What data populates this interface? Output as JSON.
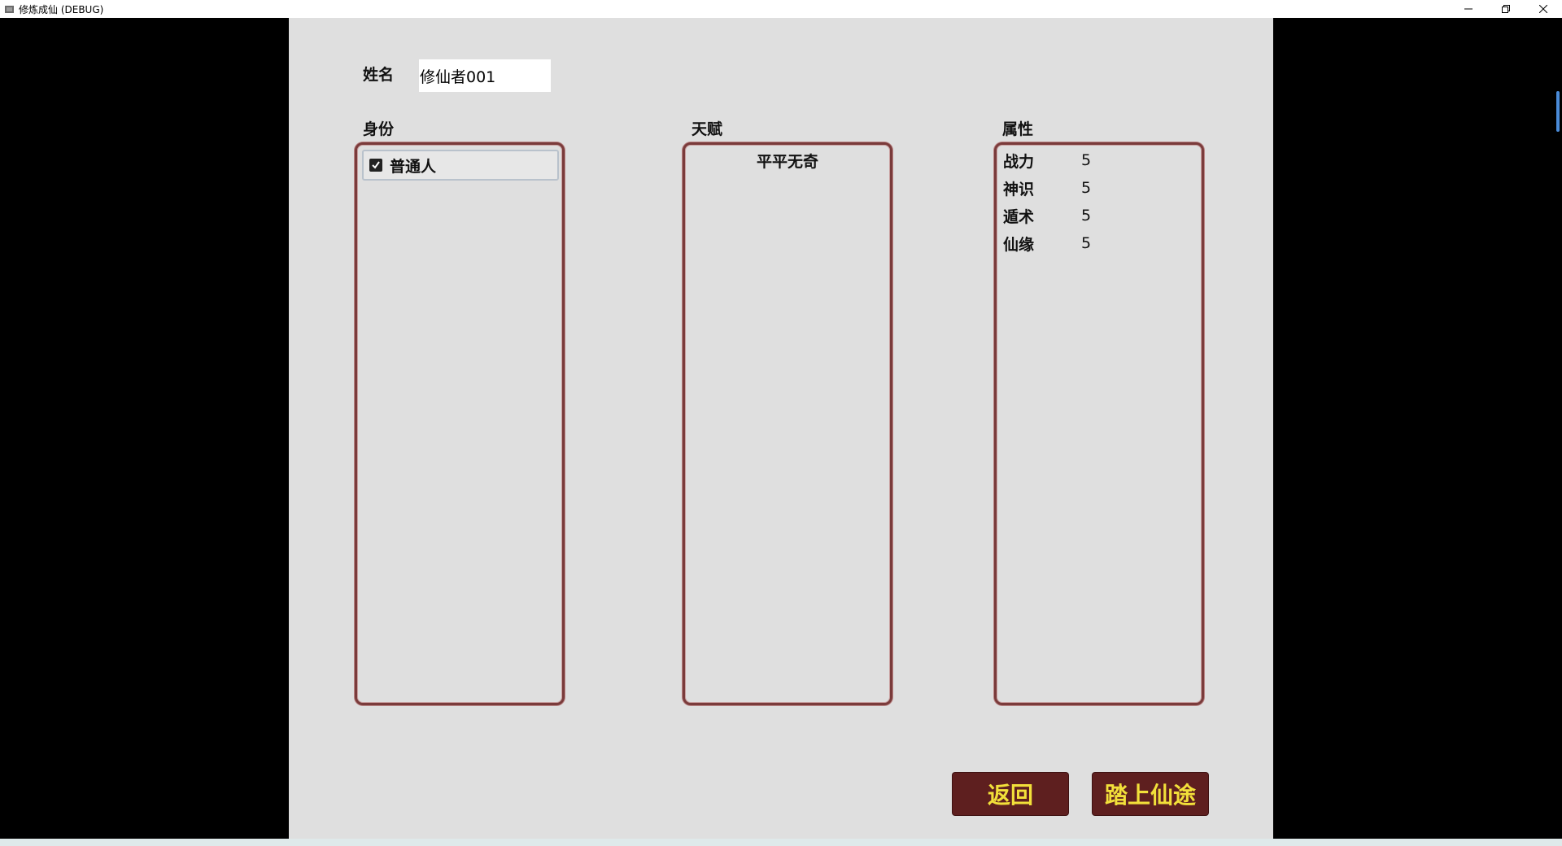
{
  "window": {
    "title": "修炼成仙 (DEBUG)",
    "icons": [
      "app-icon",
      "minimize-icon",
      "restore-icon",
      "close-icon"
    ]
  },
  "name": {
    "label": "姓名",
    "value": "修仙者001"
  },
  "identity": {
    "label": "身份",
    "items": [
      {
        "text": "普通人",
        "checked": true
      }
    ]
  },
  "talent": {
    "label": "天赋",
    "items": [
      "平平无奇"
    ]
  },
  "attributes": {
    "label": "属性",
    "rows": [
      {
        "name": "战力",
        "value": "5"
      },
      {
        "name": "神识",
        "value": "5"
      },
      {
        "name": "遁术",
        "value": "5"
      },
      {
        "name": "仙缘",
        "value": "5"
      }
    ]
  },
  "buttons": {
    "back": "返回",
    "start": "踏上仙途"
  },
  "colors": {
    "panel_bg": "#dfdfdf",
    "box_border": "#7a3b3b",
    "button_bg": "#5e1f1f",
    "button_text": "#f2e03a"
  }
}
